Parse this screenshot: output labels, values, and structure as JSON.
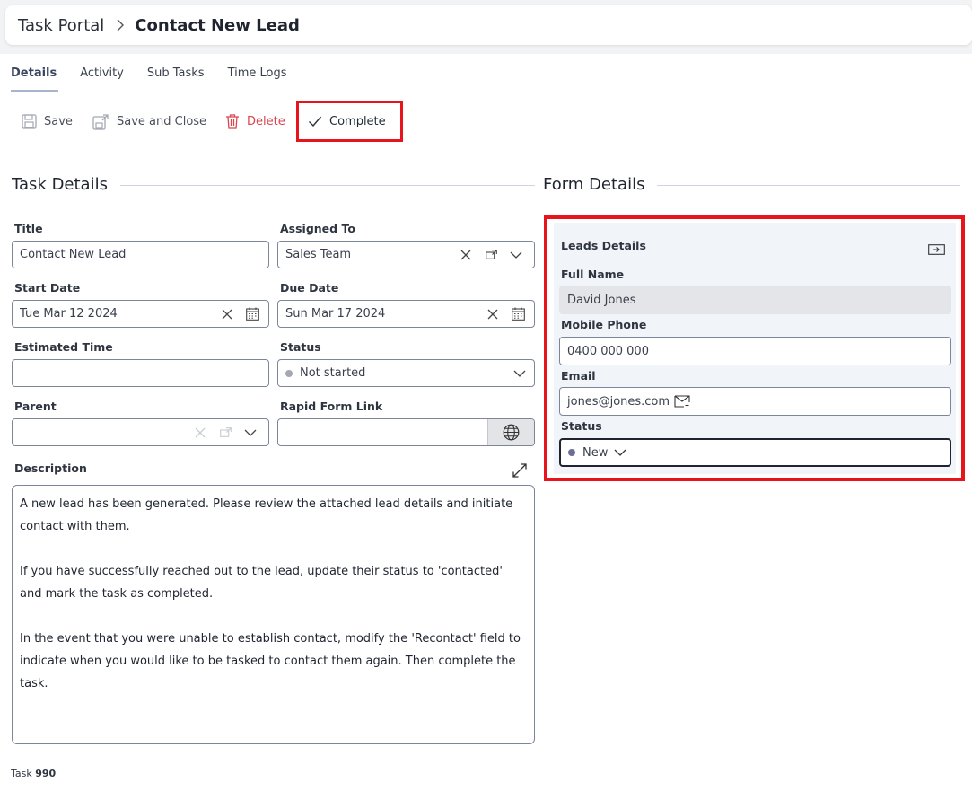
{
  "header": {
    "root": "Task Portal",
    "current": "Contact New Lead"
  },
  "tabs": [
    "Details",
    "Activity",
    "Sub Tasks",
    "Time Logs"
  ],
  "toolbar": {
    "save": "Save",
    "save_close": "Save and Close",
    "delete": "Delete",
    "complete": "Complete"
  },
  "task_details": {
    "section_title": "Task Details",
    "title_label": "Title",
    "title_value": "Contact New Lead",
    "assigned_label": "Assigned To",
    "assigned_value": "Sales Team",
    "start_label": "Start Date",
    "start_value": "Tue Mar 12 2024",
    "due_label": "Due Date",
    "due_value": "Sun Mar 17 2024",
    "est_label": "Estimated Time",
    "est_value": "",
    "status_label": "Status",
    "status_value": "Not started",
    "parent_label": "Parent",
    "parent_value": "",
    "rapid_label": "Rapid Form Link",
    "rapid_value": "",
    "desc_label": "Description",
    "desc_paragraphs": [
      "A new lead has been generated. Please review the attached lead details and initiate contact with them.",
      "If you have successfully reached out to the lead, update their status to 'contacted' and mark the task as completed.",
      "In the event that you were unable to establish contact, modify the 'Recontact' field to indicate when you would like to be tasked to contact them again. Then complete the task."
    ]
  },
  "form_details": {
    "section_title": "Form Details",
    "group_title": "Leads Details",
    "full_name_label": "Full Name",
    "full_name_value": "David Jones",
    "mobile_label": "Mobile Phone",
    "mobile_value": "0400 000 000",
    "email_label": "Email",
    "email_value": "jones@jones.com",
    "status_label": "Status",
    "status_value": "New"
  },
  "footer": {
    "prefix": "Task",
    "number": "990"
  },
  "colors": {
    "accent_red": "#e8141b",
    "delete_red": "#d9454e",
    "status_dot_grey": "#a3a8b3",
    "status_dot_new": "#6c6e96"
  }
}
